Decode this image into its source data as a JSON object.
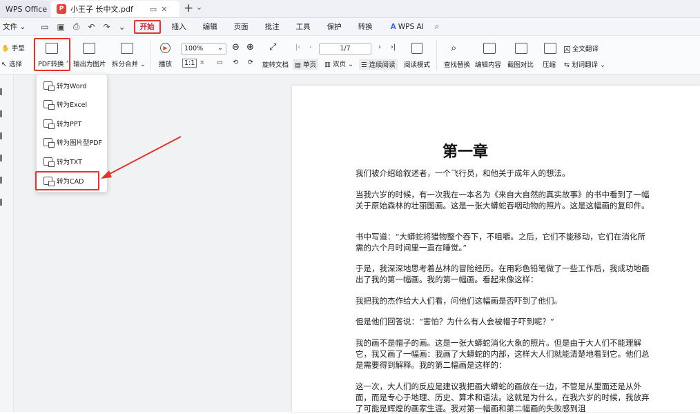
{
  "titlebar": {
    "home_tab": "WPS Office",
    "doc_tab": "小王子 长中文.pdf",
    "doc_badge": "P",
    "new_tab": "+",
    "tab_menu": "⌄"
  },
  "menubar": {
    "file": "文件",
    "items": [
      "开始",
      "插入",
      "编辑",
      "页面",
      "批注",
      "工具",
      "保护",
      "转换"
    ],
    "ai": "WPS AI"
  },
  "ribbon": {
    "hand": "手型",
    "select": "选择",
    "pdf_convert": "PDF转换",
    "export_image": "输出为图片",
    "split_merge": "拆分合并",
    "play": "播放",
    "zoom": "100%",
    "page": "1/7",
    "rotate": "旋转文档",
    "single": "单页",
    "double": "双页",
    "continuous": "连续阅读",
    "read_mode": "阅读模式",
    "find_replace": "查找替换",
    "edit_content": "编辑内容",
    "screenshot_compare": "截图对比",
    "compress": "压缩",
    "full_translate": "全文翻译",
    "word_translate": "划词翻译"
  },
  "dropdown": {
    "items": [
      "转为Word",
      "转为Excel",
      "转为PPT",
      "转为图片型PDF",
      "转为TXT",
      "转为CAD"
    ]
  },
  "document": {
    "chapter": "第一章",
    "paragraphs": [
      "我们被介绍给叙述者，一个飞行员，和他关于成年人的想法。",
      "当我六岁的时候，有一次我在一本名为《来自大自然的真实故事》的书中看到了一幅关于原始森林的壮丽图画。这是一张大蟒蛇吞咽动物的照片。这是这幅画的复印件。",
      "书中写道：“大蟒蛇将猎物整个吞下，不咀嚼。之后，它们不能移动，它们在消化所需的六个月时间里一直在睡觉。”",
      "于是，我深深地思考着丛林的冒险经历。在用彩色铅笔做了一些工作后，我成功地画出了我的第一幅画。我的第一幅画。看起来像这样：",
      "我把我的杰作给大人们看，问他们这幅画是否吓到了他们。",
      "但是他们回答说：“害怕？为什么有人会被帽子吓到呢？”",
      "我的画不是帽子的画。这是一张大蟒蛇消化大象的照片。但是由于大人们不能理解它，我又画了一幅画：我画了大蟒蛇的内部，这样大人们就能清楚地看到它。他们总是需要得到解释。我的第二幅画是这样的：",
      "这一次，大人们的反应是建议我把画大蟒蛇的画放在一边，不管是从里面还是从外面，而是专心于地理、历史、算术和语法。这就是为什么，在我六岁的时候，我放弃了可能是辉煌的画家生涯。我对第一幅画和第二幅画的失败感到沮"
    ]
  },
  "colors": {
    "accent_red": "#e6332a",
    "canvas_bg": "#f1f2f4"
  }
}
